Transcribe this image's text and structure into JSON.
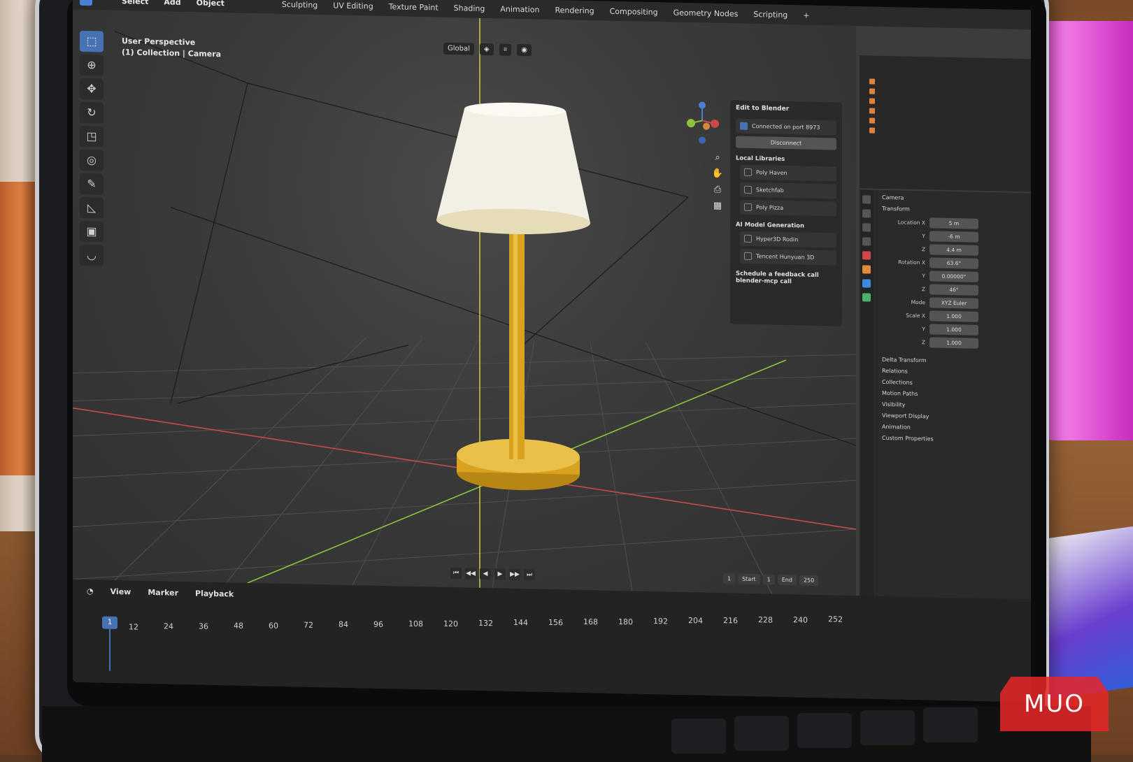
{
  "window": {
    "menus": [
      "Select",
      "Add",
      "Object"
    ],
    "workspace_tabs": [
      "Sculpting",
      "UV Editing",
      "Texture Paint",
      "Shading",
      "Animation",
      "Rendering",
      "Compositing",
      "Geometry Nodes",
      "Scripting",
      "+"
    ]
  },
  "viewport": {
    "title_line1": "User Perspective",
    "title_line2": "(1) Collection | Camera",
    "orientation_label": "Global",
    "toolbar_icons": [
      "select-box-icon",
      "cursor-icon",
      "move-icon",
      "rotate-icon",
      "scale-icon",
      "transform-icon",
      "annotate-icon",
      "measure-icon",
      "add-cube-icon",
      "extrude-icon"
    ]
  },
  "sidebar_panel": {
    "header": "Edit to Blender",
    "connect_label": "Connected on port 8973",
    "disconnect_label": "Disconnect",
    "section_local": "Local Libraries",
    "local_items": [
      "Poly Haven",
      "Sketchfab",
      "Poly Pizza"
    ],
    "section_ai": "AI Model Generation",
    "ai_items": [
      "Hyper3D Rodin",
      "Tencent Hunyuan 3D"
    ],
    "schedule_line1": "Schedule a feedback call",
    "schedule_line2": "blender-mcp call"
  },
  "properties": {
    "object_name": "Camera",
    "transform_section": "Transform",
    "location_label": "Location X",
    "rotation_label": "Rotation X",
    "mode_label": "Mode",
    "mode_value": "XYZ Euler",
    "scale_label": "Scale X",
    "axis_y": "Y",
    "axis_z": "Z",
    "location_values": [
      "5 m",
      "-6 m",
      "4.4 m"
    ],
    "rotation_values": [
      "63.6°",
      "0.00000°",
      "46°"
    ],
    "scale_values": [
      "1.000",
      "1.000",
      "1.000"
    ],
    "collapsed_sections": [
      "Delta Transform",
      "Relations",
      "Collections",
      "Motion Paths",
      "Visibility",
      "Viewport Display",
      "Animation",
      "Custom Properties"
    ]
  },
  "timeline": {
    "menu_items": [
      "View",
      "Marker",
      "Playback"
    ],
    "current_frame": "1",
    "frame_labels": [
      "12",
      "24",
      "36",
      "48",
      "60",
      "72",
      "84",
      "96",
      "108",
      "120",
      "132",
      "144",
      "156",
      "168",
      "180",
      "192",
      "204",
      "216",
      "228",
      "240",
      "252"
    ],
    "start_label": "Start",
    "start_value": "1",
    "end_label": "End",
    "end_value": "250"
  },
  "watermark": {
    "text": "MUO"
  },
  "colors": {
    "accent": "#4772b3",
    "x_axis": "#c94a4a",
    "y_axis": "#8ec13f",
    "z_axis": "#d8d84a",
    "lamp_gold": "#d9a21e",
    "lamp_shade": "#f2efe4"
  }
}
